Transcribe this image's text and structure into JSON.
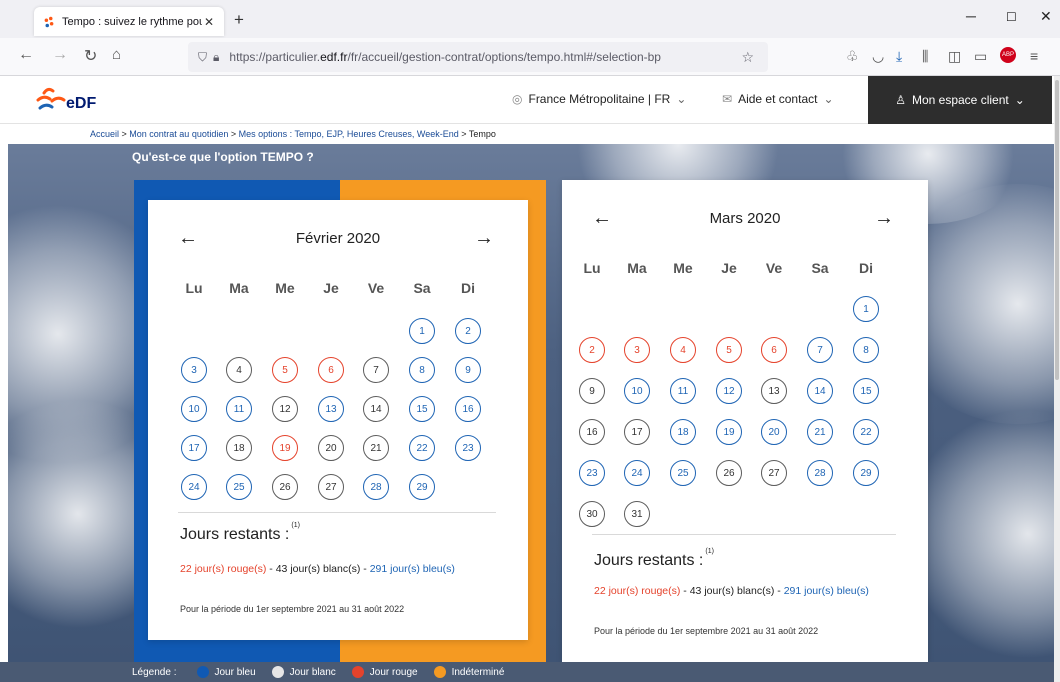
{
  "browser": {
    "tab_title": "Tempo : suivez le rythme pour c",
    "url_prefix": "https://particulier.",
    "url_domain": "edf.fr",
    "url_rest": "/fr/accueil/gestion-contrat/options/tempo.html#/selection-bp"
  },
  "header": {
    "region": "France Métropolitaine | FR",
    "aide": "Aide et contact",
    "espace": "Mon espace client"
  },
  "breadcrumb": {
    "items": [
      "Accueil",
      "Mon contrat au quotidien",
      "Mes options : Tempo, EJP, Heures Creuses, Week-End"
    ],
    "current": "Tempo",
    "sep": " > "
  },
  "section_title": "Qu'est-ce que l'option TEMPO ?",
  "weekdays": [
    "Lu",
    "Ma",
    "Me",
    "Je",
    "Ve",
    "Sa",
    "Di"
  ],
  "calendars": [
    {
      "month": "Février 2020",
      "first_weekday": 5,
      "days": [
        "bleu",
        "bleu",
        "bleu",
        "blanc",
        "rouge",
        "rouge",
        "blanc",
        "bleu",
        "bleu",
        "bleu",
        "bleu",
        "blanc",
        "bleu",
        "blanc",
        "bleu",
        "bleu",
        "bleu",
        "blanc",
        "rouge",
        "blanc",
        "blanc",
        "bleu",
        "bleu",
        "bleu",
        "bleu",
        "blanc",
        "blanc",
        "bleu",
        "bleu"
      ]
    },
    {
      "month": "Mars 2020",
      "first_weekday": 6,
      "days": [
        "bleu",
        "rouge",
        "rouge",
        "rouge",
        "rouge",
        "rouge",
        "bleu",
        "bleu",
        "blanc",
        "bleu",
        "bleu",
        "bleu",
        "blanc",
        "bleu",
        "bleu",
        "blanc",
        "blanc",
        "bleu",
        "bleu",
        "bleu",
        "bleu",
        "bleu",
        "bleu",
        "bleu",
        "bleu",
        "blanc",
        "blanc",
        "bleu",
        "bleu",
        "blanc",
        "blanc"
      ]
    }
  ],
  "remaining": {
    "title": "Jours restants :",
    "note": "(1)",
    "rouge": "22 jour(s) rouge(s)",
    "blanc": "43 jour(s) blanc(s)",
    "bleu": "291 jour(s) bleu(s)",
    "dash": " - ",
    "period": "Pour la période du 1er septembre 2021 au 31 août 2022"
  },
  "legend": {
    "label": "Légende :",
    "items": [
      {
        "label": "Jour bleu",
        "color": "#1059b3"
      },
      {
        "label": "Jour blanc",
        "color": "#e6e6e6"
      },
      {
        "label": "Jour rouge",
        "color": "#e5432c"
      },
      {
        "label": "Indéterminé",
        "color": "#f59a22"
      }
    ]
  },
  "colors": {
    "bleu": "#1e64b4",
    "rouge": "#e5432c",
    "blanc": "#5c5c5c",
    "edf_orange": "#fe5815",
    "edf_blue": "#001a70"
  }
}
